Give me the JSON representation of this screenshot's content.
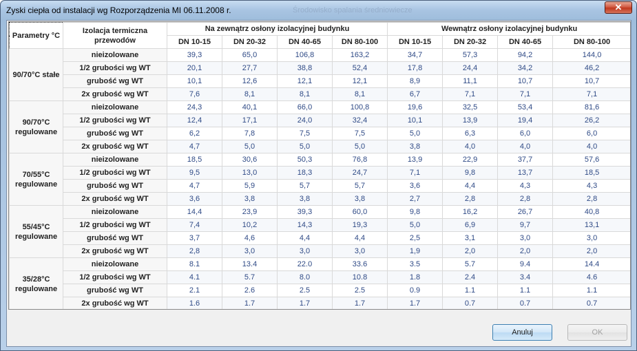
{
  "window": {
    "title": "Zyski ciepła od instalacji wg Rozporządzenia MI 06.11.2008 r.",
    "background_title": "Środowisko spalania średniowiecze",
    "close_label": "✕"
  },
  "table": {
    "header_params": "Parametry °C",
    "header_insulation": "Izolacja termiczna przewodów",
    "header_outside": "Na zewnątrz osłony izolacyjnej budynku",
    "header_inside": "Wewnątrz osłony izolacyjnej budynku",
    "dn_columns": [
      "DN 10-15",
      "DN 20-32",
      "DN 40-65",
      "DN 80-100",
      "DN 10-15",
      "DN 20-32",
      "DN 40-65",
      "DN 80-100"
    ],
    "groups": [
      {
        "label": "90/70°C stałe",
        "rows": [
          {
            "insulation": "nieizolowane",
            "values": [
              "39,3",
              "65,0",
              "106,8",
              "163,2",
              "34,7",
              "57,3",
              "94,2",
              "144,0"
            ]
          },
          {
            "insulation": "1/2 grubości wg WT",
            "values": [
              "20,1",
              "27,7",
              "38,8",
              "52,4",
              "17,8",
              "24,4",
              "34,2",
              "46,2"
            ]
          },
          {
            "insulation": "grubość wg WT",
            "values": [
              "10,1",
              "12,6",
              "12,1",
              "12,1",
              "8,9",
              "11,1",
              "10,7",
              "10,7"
            ]
          },
          {
            "insulation": "2x grubość wg WT",
            "values": [
              "7,6",
              "8,1",
              "8,1",
              "8,1",
              "6,7",
              "7,1",
              "7,1",
              "7,1"
            ]
          }
        ]
      },
      {
        "label": "90/70°C regulowane",
        "rows": [
          {
            "insulation": "nieizolowane",
            "values": [
              "24,3",
              "40,1",
              "66,0",
              "100,8",
              "19,6",
              "32,5",
              "53,4",
              "81,6"
            ]
          },
          {
            "insulation": "1/2 grubości wg WT",
            "values": [
              "12,4",
              "17,1",
              "24,0",
              "32,4",
              "10,1",
              "13,9",
              "19,4",
              "26,2"
            ]
          },
          {
            "insulation": "grubość wg WT",
            "values": [
              "6,2",
              "7,8",
              "7,5",
              "7,5",
              "5,0",
              "6,3",
              "6,0",
              "6,0"
            ]
          },
          {
            "insulation": "2x grubość wg WT",
            "values": [
              "4,7",
              "5,0",
              "5,0",
              "5,0",
              "3,8",
              "4,0",
              "4,0",
              "4,0"
            ]
          }
        ]
      },
      {
        "label": "70/55°C regulowane",
        "rows": [
          {
            "insulation": "nieizolowane",
            "values": [
              "18,5",
              "30,6",
              "50,3",
              "76,8",
              "13,9",
              "22,9",
              "37,7",
              "57,6"
            ]
          },
          {
            "insulation": "1/2 grubości wg WT",
            "values": [
              "9,5",
              "13,0",
              "18,3",
              "24,7",
              "7,1",
              "9,8",
              "13,7",
              "18,5"
            ]
          },
          {
            "insulation": "grubość wg WT",
            "values": [
              "4,7",
              "5,9",
              "5,7",
              "5,7",
              "3,6",
              "4,4",
              "4,3",
              "4,3"
            ]
          },
          {
            "insulation": "2x grubość wg WT",
            "values": [
              "3,6",
              "3,8",
              "3,8",
              "3,8",
              "2,7",
              "2,8",
              "2,8",
              "2,8"
            ]
          }
        ]
      },
      {
        "label": "55/45°C regulowane",
        "rows": [
          {
            "insulation": "nieizolowane",
            "values": [
              "14,4",
              "23,9",
              "39,3",
              "60,0",
              "9,8",
              "16,2",
              "26,7",
              "40,8"
            ]
          },
          {
            "insulation": "1/2 grubości wg WT",
            "values": [
              "7,4",
              "10,2",
              "14,3",
              "19,3",
              "5,0",
              "6,9",
              "9,7",
              "13,1"
            ]
          },
          {
            "insulation": "grubość wg WT",
            "values": [
              "3,7",
              "4,6",
              "4,4",
              "4,4",
              "2,5",
              "3,1",
              "3,0",
              "3,0"
            ]
          },
          {
            "insulation": "2x grubość wg WT",
            "values": [
              "2,8",
              "3,0",
              "3,0",
              "3,0",
              "1,9",
              "2,0",
              "2,0",
              "2,0"
            ]
          }
        ]
      },
      {
        "label": "35/28°C regulowane",
        "rows": [
          {
            "insulation": "nieizolowane",
            "values": [
              "8.1",
              "13.4",
              "22.0",
              "33.6",
              "3.5",
              "5.7",
              "9.4",
              "14.4"
            ]
          },
          {
            "insulation": "1/2 grubości wg WT",
            "values": [
              "4.1",
              "5.7",
              "8.0",
              "10.8",
              "1.8",
              "2.4",
              "3.4",
              "4.6"
            ]
          },
          {
            "insulation": "grubość wg WT",
            "values": [
              "2.1",
              "2.6",
              "2.5",
              "2.5",
              "0.9",
              "1.1",
              "1.1",
              "1.1"
            ]
          },
          {
            "insulation": "2x grubość wg WT",
            "values": [
              "1.6",
              "1.7",
              "1.7",
              "1.7",
              "1.7",
              "0.7",
              "0.7",
              "0.7"
            ]
          }
        ]
      }
    ]
  },
  "buttons": {
    "cancel": "Anuluj",
    "ok": "OK"
  }
}
